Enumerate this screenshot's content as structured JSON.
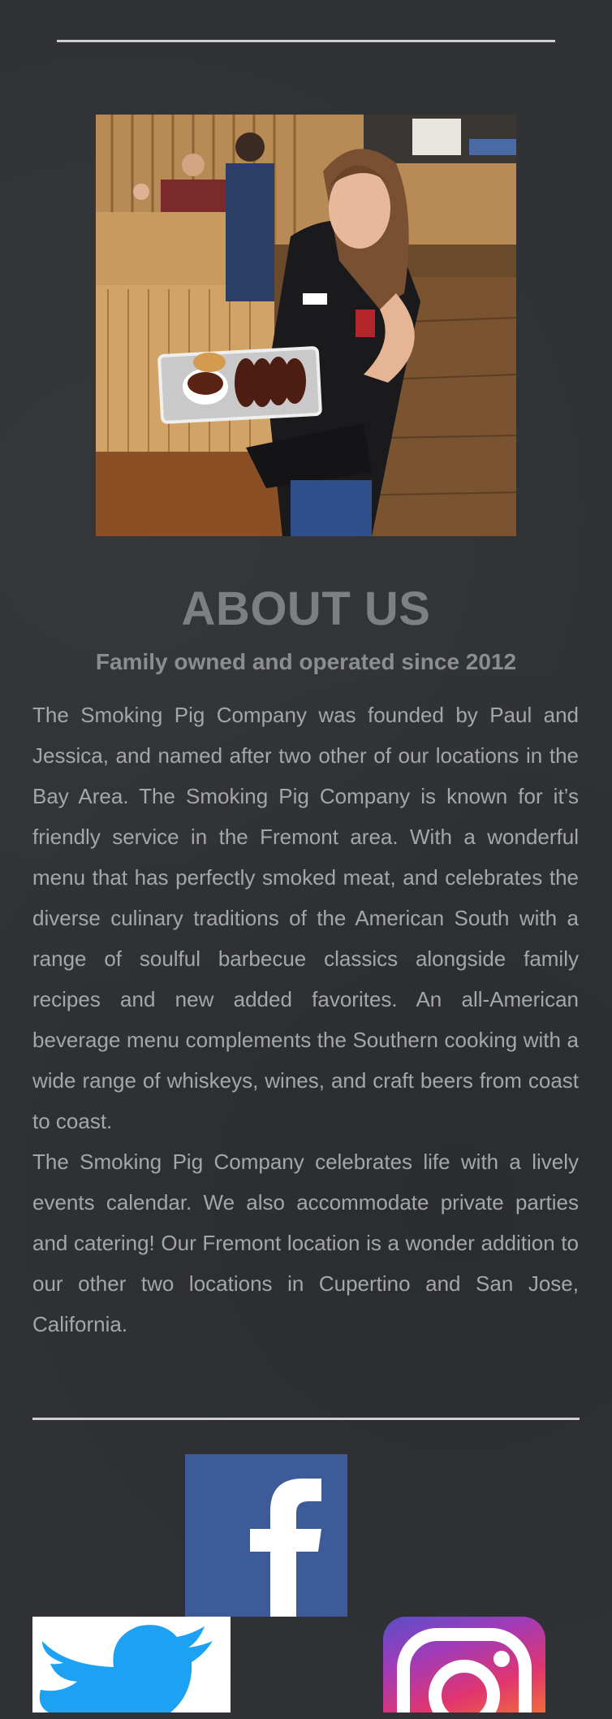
{
  "about": {
    "title": "ABOUT US",
    "subtitle": "Family owned and operated since 2012",
    "paragraphs": [
      "The Smoking Pig Company was founded by Paul and Jessica, and named after two other of our locations in the Bay Area. The Smoking Pig Company is known for it’s friendly service in the Fremont area. With a wonderful menu that has perfectly smoked meat, and celebrates the diverse culinary traditions of the American South with a range of soulful barbecue classics alongside family recipes and new added favorites. An all-American beverage menu complements the Southern cooking with a wide range of whiskeys, wines, and craft beers from coast to coast.",
      "The Smoking Pig Company celebrates life with a lively events calendar. We also accommodate private parties and catering! Our Fremont location is a wonder addition to our other two locations in Cupertino and San Jose, California."
    ]
  },
  "photo": {
    "subject": "server-with-brisket-tray"
  },
  "social": {
    "facebook": {
      "icon": "facebook-icon",
      "color": "#3d5b99"
    },
    "twitter": {
      "icon": "twitter-icon",
      "color": "#1da1f2"
    },
    "instagram": {
      "icon": "instagram-icon"
    }
  },
  "colors": {
    "background": "#303236",
    "rule": "#cfcfcf",
    "heading": "#7e7f82",
    "text": "#a5a6a9"
  }
}
